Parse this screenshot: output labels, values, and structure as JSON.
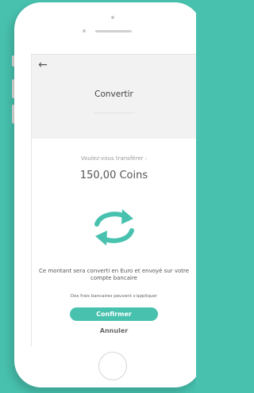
{
  "colors": {
    "background": "#48c2af",
    "accent": "#48c2af",
    "device": "#ffffff",
    "screen_header": "#f2f2f2"
  },
  "header": {
    "back_icon": "arrow-left-icon",
    "back_glyph": "←",
    "title": "Convertir"
  },
  "transfer": {
    "question": "Voulez-vous transférer :",
    "amount": "150,00 Coins",
    "convert_icon": "convert-arrows-icon"
  },
  "notice": {
    "message": "Ce montant sera converti en Euro et envoyé sur votre compte bancaire",
    "fees": "Des frais bancaires peuvent s'appliquer"
  },
  "actions": {
    "confirm_label": "Confirmer",
    "cancel_label": "Annuler"
  }
}
